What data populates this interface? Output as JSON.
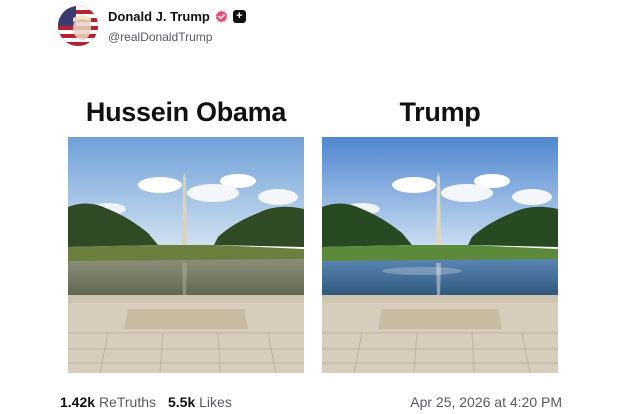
{
  "author": {
    "display_name": "Donald J. Trump",
    "handle": "@realDonaldTrump"
  },
  "panels": [
    {
      "title": "Hussein Obama"
    },
    {
      "title": "Trump"
    }
  ],
  "stats": {
    "retruths_count": "1.42k",
    "retruths_label": "ReTruths",
    "likes_count": "5.5k",
    "likes_label": "Likes"
  },
  "timestamp": "Apr 25, 2026 at 4:20 PM",
  "colors": {
    "verified_badge": "#e34f72",
    "text_primary": "#111111",
    "text_secondary": "#555a60"
  }
}
